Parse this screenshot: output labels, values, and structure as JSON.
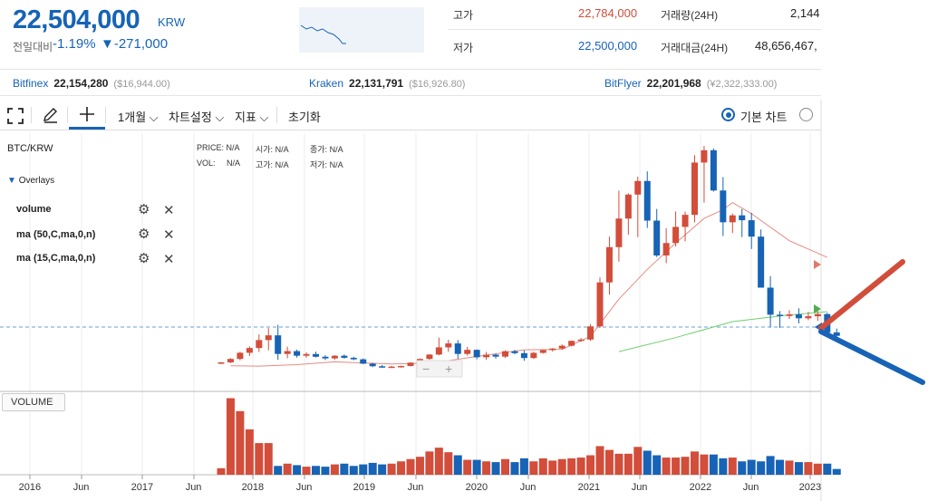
{
  "header": {
    "price": "22,504,000",
    "currency": "KRW",
    "change_label": "전일대비",
    "change_pct": "-1.19%",
    "change_abs": "▼-271,000",
    "high_label": "고가",
    "high_value": "22,784,000",
    "low_label": "저가",
    "low_value": "22,500,000",
    "volume_label": "거래량(24H)",
    "volume_value": "2,144",
    "amount_label": "거래대금(24H)",
    "amount_value": "48,656,467,"
  },
  "exchanges": [
    {
      "name": "Bitfinex",
      "value": "22,154,280",
      "usd": "($16,944.00)"
    },
    {
      "name": "Kraken",
      "value": "22,131,791",
      "usd": "($16,926.80)"
    },
    {
      "name": "BitFlyer",
      "value": "22,201,968",
      "usd": "(¥2,322,333.00)"
    }
  ],
  "toolbar": {
    "period": "1개월",
    "chart_settings": "차트설정",
    "indicators": "지표",
    "reset": "초기화",
    "basic_chart": "기본 차트"
  },
  "chart": {
    "symbol": "BTC/KRW",
    "overlays_label": "Overlays",
    "overlays": [
      "volume",
      "ma (50,C,ma,0,n)",
      "ma (15,C,ma,0,n)"
    ],
    "info": {
      "price_label": "PRICE:",
      "price_val": "N/A",
      "vol_label": "VOL:",
      "vol_val": "N/A",
      "open_label": "시가:",
      "open_val": "N/A",
      "high_label": "고가:",
      "high_val": "N/A",
      "close_label": "종가:",
      "close_val": "N/A",
      "low_label": "저가:",
      "low_val": "N/A"
    },
    "volume_btn": "VOLUME"
  },
  "colors": {
    "up": "#d24d3a",
    "down": "#1763b6",
    "ma50": "#e88a80",
    "ma15": "#6fcf6f"
  },
  "chart_data": {
    "type": "bar",
    "x_ticks": [
      "2016",
      "Jun",
      "2017",
      "Jun",
      "2018",
      "Jun",
      "2019",
      "Jun",
      "2020",
      "Jun",
      "2021",
      "Jun",
      "2022",
      "Jun",
      "2023"
    ],
    "candles": [
      [
        20.6,
        21.4,
        19.9,
        21.2
      ],
      [
        21.2,
        24.5,
        20.7,
        23.9
      ],
      [
        23.9,
        29.5,
        22.8,
        28.7
      ],
      [
        28.7,
        33.8,
        26.1,
        32.4
      ],
      [
        32.4,
        43.0,
        29.3,
        38.6
      ],
      [
        38.6,
        48.0,
        30.6,
        42.3
      ],
      [
        42.3,
        50.5,
        23.2,
        27.8
      ],
      [
        27.8,
        33.5,
        24.4,
        30.0
      ],
      [
        30.0,
        31.2,
        24.9,
        26.4
      ],
      [
        26.4,
        29.0,
        24.8,
        27.7
      ],
      [
        27.7,
        29.5,
        25.0,
        25.6
      ],
      [
        25.6,
        26.8,
        23.0,
        24.3
      ],
      [
        24.3,
        27.0,
        23.4,
        26.4
      ],
      [
        26.4,
        27.4,
        24.1,
        24.8
      ],
      [
        24.8,
        25.6,
        22.9,
        23.6
      ],
      [
        23.6,
        24.3,
        19.9,
        20.2
      ],
      [
        20.2,
        20.9,
        17.5,
        18.2
      ],
      [
        18.2,
        19.2,
        17.0,
        17.7
      ],
      [
        17.7,
        18.4,
        16.9,
        17.9
      ],
      [
        17.9,
        18.6,
        17.1,
        18.4
      ],
      [
        18.4,
        21.4,
        18.0,
        21.0
      ],
      [
        21.0,
        24.3,
        20.6,
        23.9
      ],
      [
        23.9,
        27.6,
        23.1,
        27.3
      ],
      [
        27.3,
        40.5,
        26.8,
        32.9
      ],
      [
        32.9,
        38.9,
        29.4,
        36.0
      ],
      [
        36.0,
        38.6,
        24.0,
        27.8
      ],
      [
        27.8,
        33.2,
        26.5,
        31.0
      ],
      [
        31.0,
        31.3,
        23.6,
        25.2
      ],
      [
        25.2,
        29.4,
        23.2,
        27.2
      ],
      [
        27.2,
        28.1,
        24.2,
        25.7
      ],
      [
        25.7,
        30.6,
        24.7,
        29.9
      ],
      [
        29.9,
        31.0,
        27.5,
        28.4
      ],
      [
        28.4,
        30.6,
        22.4,
        24.6
      ],
      [
        24.6,
        29.5,
        23.8,
        28.6
      ],
      [
        28.6,
        31.0,
        28.1,
        30.8
      ],
      [
        30.8,
        32.4,
        29.6,
        32.0
      ],
      [
        32.0,
        35.2,
        31.2,
        34.2
      ],
      [
        34.2,
        38.2,
        33.6,
        38.0
      ],
      [
        38.0,
        40.2,
        37.2,
        39.0
      ],
      [
        39.0,
        51.1,
        37.9,
        49.3
      ],
      [
        49.3,
        87.5,
        48.2,
        83.6
      ],
      [
        83.6,
        119.3,
        74.0,
        111.1
      ],
      [
        111.1,
        155.1,
        99.8,
        133.4
      ],
      [
        133.4,
        153.1,
        120.8,
        152.1
      ],
      [
        152.1,
        166.1,
        118.9,
        162.7
      ],
      [
        162.7,
        170.2,
        126.1,
        131.8
      ],
      [
        131.8,
        140.9,
        103.4,
        104.6
      ],
      [
        104.6,
        125.9,
        98.6,
        114.3
      ],
      [
        114.3,
        138.9,
        111.6,
        126.9
      ],
      [
        126.9,
        138.9,
        115.7,
        136.3
      ],
      [
        136.3,
        182.9,
        130.5,
        177.1
      ],
      [
        177.1,
        190.0,
        145.9,
        186.7
      ],
      [
        186.7,
        188.1,
        154.4,
        155.3
      ],
      [
        155.3,
        165.7,
        119.8,
        130.5
      ],
      [
        130.5,
        137.3,
        122.1,
        135.9
      ],
      [
        135.9,
        140.8,
        118.9,
        132.1
      ],
      [
        132.1,
        137.9,
        109.6,
        119.3
      ],
      [
        119.3,
        124.9,
        79.7,
        79.5
      ],
      [
        79.5,
        88.5,
        48.4,
        58.4
      ],
      [
        58.4,
        61.2,
        48.2,
        57.4
      ],
      [
        57.4,
        61.8,
        55.1,
        58.6
      ],
      [
        58.6,
        63.4,
        51.6,
        55.6
      ],
      [
        55.6,
        60.6,
        54.1,
        57.2
      ],
      [
        57.2,
        61.3,
        53.5,
        58.9
      ],
      [
        58.9,
        59.9,
        43.3,
        44.6
      ],
      [
        44.6,
        47.6,
        40.3,
        41.9
      ]
    ],
    "volume": [
      5,
      97,
      80,
      56,
      38,
      38,
      8,
      11,
      9,
      7,
      8,
      7,
      10,
      11,
      8,
      10,
      12,
      10,
      11,
      14,
      17,
      20,
      27,
      32,
      26,
      22,
      16,
      16,
      14,
      13,
      17,
      13,
      18,
      14,
      18,
      15,
      17,
      18,
      19,
      22,
      34,
      29,
      24,
      24,
      33,
      28,
      22,
      19,
      19,
      20,
      27,
      23,
      23,
      18,
      19,
      14,
      16,
      14,
      21,
      16,
      15,
      13,
      13,
      11,
      11,
      4
    ],
    "ma15": [
      [
        1.0,
        18.6
      ],
      [
        4.0,
        18.3
      ],
      [
        8.0,
        19.4
      ],
      [
        12.0,
        21.6
      ],
      [
        18.0,
        20.0
      ],
      [
        22.0,
        20.6
      ],
      [
        26.0,
        24.7
      ],
      [
        32.0,
        31.0
      ],
      [
        36.0,
        31.4
      ],
      [
        39.0,
        41.5
      ],
      [
        42.0,
        70.5
      ],
      [
        45.0,
        93.8
      ],
      [
        48.0,
        114.3
      ],
      [
        51.0,
        133.5
      ],
      [
        53.0,
        140.3
      ],
      [
        54.0,
        145.9
      ],
      [
        56.0,
        137.2
      ],
      [
        60.0,
        116.1
      ],
      [
        64.0,
        103.1
      ]
    ],
    "ma50": [
      [
        42.0,
        29.6
      ],
      [
        48.0,
        40.5
      ],
      [
        54.0,
        53.0
      ],
      [
        60.0,
        58.2
      ],
      [
        64.0,
        60.8
      ]
    ]
  }
}
